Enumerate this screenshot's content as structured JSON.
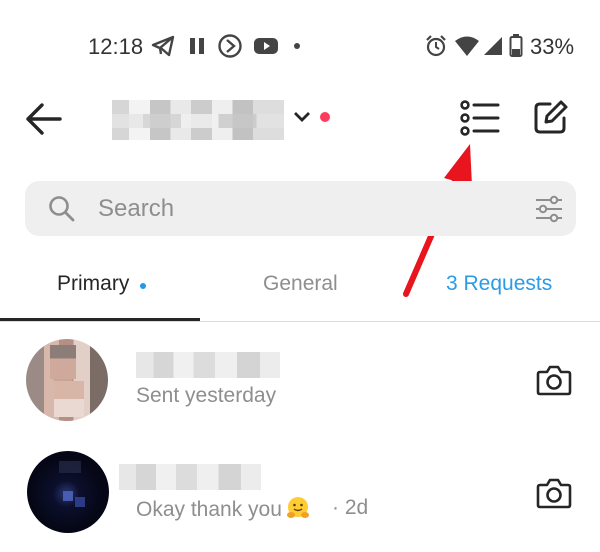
{
  "status_bar": {
    "time": "12:18",
    "battery": "33%",
    "icons": [
      "telegram-icon",
      "pause-icon",
      "play-circle-icon",
      "youtube-icon",
      "dot-icon",
      "alarm-icon",
      "wifi-icon",
      "signal-icon",
      "battery-icon"
    ]
  },
  "header": {
    "account_name": "",
    "back_icon": "back-arrow-icon",
    "list_icon": "list-icon",
    "compose_icon": "new-message-icon",
    "notification_dot_color": "#ff3b5c"
  },
  "search": {
    "placeholder": "Search",
    "value": ""
  },
  "tabs": [
    {
      "label": "Primary",
      "active": true
    },
    {
      "label": "General",
      "active": false
    },
    {
      "label": "3 Requests",
      "active": false
    }
  ],
  "threads": [
    {
      "name": "",
      "subtitle": "Sent yesterday",
      "time": "",
      "camera_icon": "camera-icon"
    },
    {
      "name": "",
      "subtitle": "Okay thank you",
      "emoji": "hugging-face-emoji",
      "time": "· 2d",
      "camera_icon": "camera-icon"
    }
  ],
  "annotation": {
    "arrow_color": "#e8141e"
  }
}
